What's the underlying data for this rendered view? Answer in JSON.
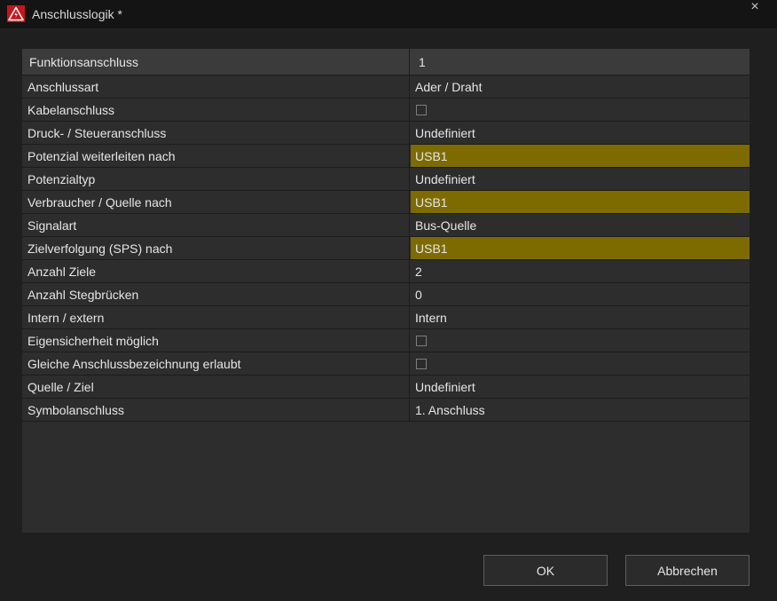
{
  "window": {
    "title": "Anschlusslogik *",
    "close_symbol": "×"
  },
  "icons": {
    "app": "warning-triangle-icon",
    "close": "close-icon"
  },
  "colors": {
    "highlight": "#7e6b00",
    "header_row": "#3b3b3b",
    "grid_bg": "#2d2d2d"
  },
  "properties": {
    "header": {
      "label": "Funktionsanschluss",
      "value": "1"
    },
    "rows": [
      {
        "label": "Anschlussart",
        "value": "Ader / Draht"
      },
      {
        "label": "Kabelanschluss",
        "type": "checkbox",
        "checked": false
      },
      {
        "label": "Druck- / Steueranschluss",
        "value": "Undefiniert"
      },
      {
        "label": "Potenzial weiterleiten nach",
        "value": "USB1",
        "highlight": true
      },
      {
        "label": "Potenzialtyp",
        "value": "Undefiniert"
      },
      {
        "label": "Verbraucher / Quelle nach",
        "value": "USB1",
        "highlight": true
      },
      {
        "label": "Signalart",
        "value": "Bus-Quelle"
      },
      {
        "label": "Zielverfolgung (SPS) nach",
        "value": "USB1",
        "highlight": true
      },
      {
        "label": "Anzahl Ziele",
        "value": "2"
      },
      {
        "label": "Anzahl Stegbrücken",
        "value": "0"
      },
      {
        "label": "Intern / extern",
        "value": "Intern"
      },
      {
        "label": "Eigensicherheit möglich",
        "type": "checkbox",
        "checked": false
      },
      {
        "label": "Gleiche Anschlussbezeichnung erlaubt",
        "type": "checkbox",
        "checked": false
      },
      {
        "label": "Quelle / Ziel",
        "value": "Undefiniert"
      },
      {
        "label": "Symbolanschluss",
        "value": "1. Anschluss"
      }
    ]
  },
  "buttons": {
    "ok": "OK",
    "cancel": "Abbrechen"
  }
}
